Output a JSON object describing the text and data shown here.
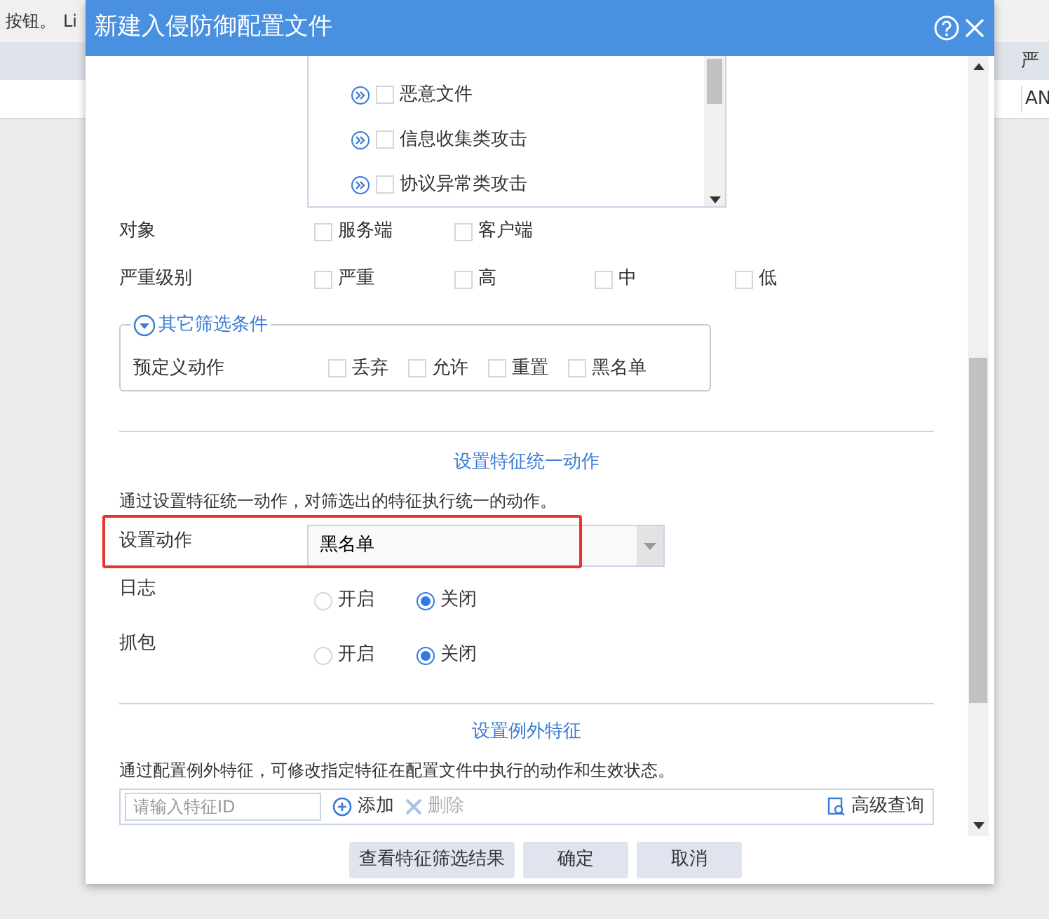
{
  "background": {
    "top_texts": [
      "按钮。",
      "Li"
    ],
    "header_cell": "严",
    "row_cell": "AN"
  },
  "dialog": {
    "title": "新建入侵防御配置文件",
    "category_list": [
      {
        "label": "恶意文件",
        "checked": false
      },
      {
        "label": "信息收集类攻击",
        "checked": false
      },
      {
        "label": "协议异常类攻击",
        "checked": false
      }
    ],
    "filters": [
      {
        "label": "对象",
        "options": [
          {
            "label": "服务端",
            "checked": false
          },
          {
            "label": "客户端",
            "checked": false
          }
        ]
      },
      {
        "label": "严重级别",
        "options": [
          {
            "label": "严重",
            "checked": false
          },
          {
            "label": "高",
            "checked": false
          },
          {
            "label": "中",
            "checked": false
          },
          {
            "label": "低",
            "checked": false
          }
        ]
      }
    ],
    "other_filters": {
      "legend": "其它筛选条件",
      "expanded": true,
      "label": "预定义动作",
      "options": [
        {
          "label": "丢弃",
          "checked": false
        },
        {
          "label": "允许",
          "checked": false
        },
        {
          "label": "重置",
          "checked": false
        },
        {
          "label": "黑名单",
          "checked": false
        }
      ]
    },
    "unified_action": {
      "heading": "设置特征统一动作",
      "description": "通过设置特征统一动作，对筛选出的特征执行统一的动作。",
      "action_label": "设置动作",
      "action_value": "黑名单",
      "highlighted": true,
      "radio_groups": [
        {
          "label": "日志",
          "options": [
            {
              "label": "开启",
              "selected": false
            },
            {
              "label": "关闭",
              "selected": true
            }
          ]
        },
        {
          "label": "抓包",
          "options": [
            {
              "label": "开启",
              "selected": false
            },
            {
              "label": "关闭",
              "selected": true
            }
          ]
        }
      ]
    },
    "exceptions": {
      "heading": "设置例外特征",
      "description": "通过配置例外特征，可修改指定特征在配置文件中执行的动作和生效状态。",
      "search_placeholder": "请输入特征ID",
      "tools": [
        {
          "kind": "add",
          "label": "添加",
          "disabled": false
        },
        {
          "kind": "delete",
          "label": "删除",
          "disabled": true
        },
        {
          "kind": "query",
          "label": "高级查询",
          "disabled": false
        }
      ]
    },
    "buttons": [
      "查看特征筛选结果",
      "确定",
      "取消"
    ]
  }
}
